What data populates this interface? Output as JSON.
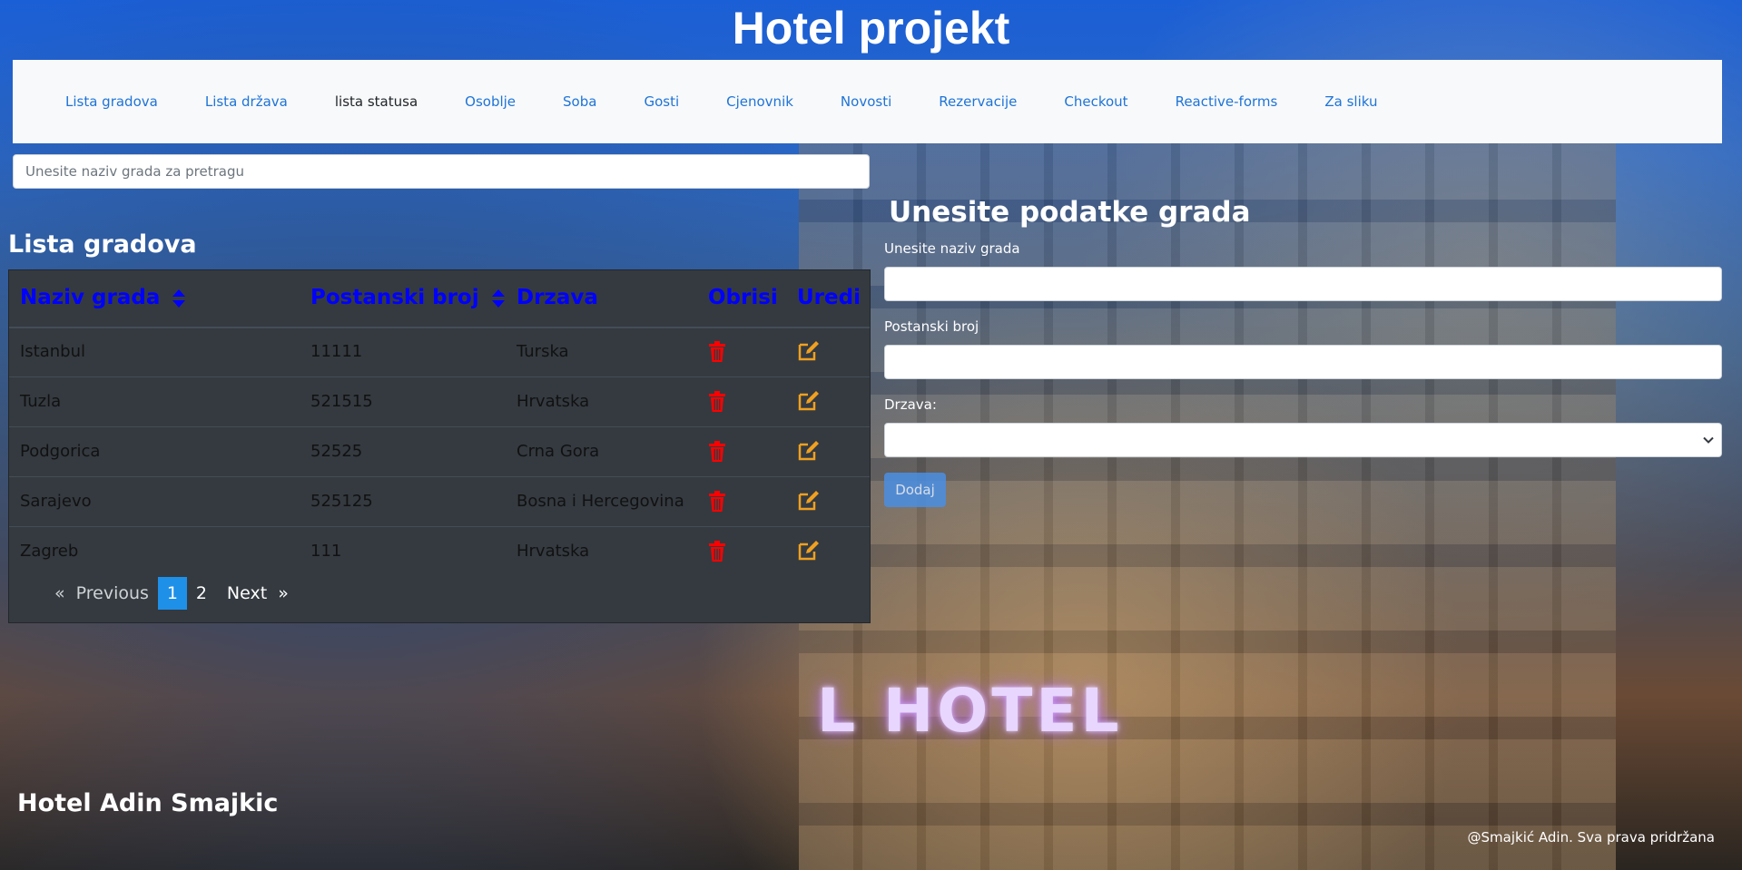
{
  "site": {
    "title": "Hotel projekt"
  },
  "nav": {
    "items": [
      {
        "label": "Lista gradova"
      },
      {
        "label": "Lista država"
      },
      {
        "label": "lista statusa"
      },
      {
        "label": "Osoblje"
      },
      {
        "label": "Soba"
      },
      {
        "label": "Gosti"
      },
      {
        "label": "Cjenovnik"
      },
      {
        "label": "Novosti"
      },
      {
        "label": "Rezervacije"
      },
      {
        "label": "Checkout"
      },
      {
        "label": "Reactive-forms"
      },
      {
        "label": "Za sliku"
      }
    ],
    "active_index": 2,
    "link_color": "#1e74d8",
    "active_color": "#212529"
  },
  "search": {
    "placeholder": "Unesite naziv grada za pretragu",
    "value": ""
  },
  "list": {
    "title": "Lista gradova",
    "columns": [
      {
        "label": "Naziv grada",
        "sortable": true
      },
      {
        "label": "Postanski broj",
        "sortable": true
      },
      {
        "label": "Drzava",
        "sortable": false
      },
      {
        "label": "Obrisi",
        "sortable": false
      },
      {
        "label": "Uredi",
        "sortable": false
      }
    ],
    "rows": [
      {
        "name": "Istanbul",
        "zip": "11111",
        "country": "Turska"
      },
      {
        "name": "Tuzla",
        "zip": "521515",
        "country": "Hrvatska"
      },
      {
        "name": "Podgorica",
        "zip": "52525",
        "country": "Crna Gora"
      },
      {
        "name": "Sarajevo",
        "zip": "525125",
        "country": "Bosna i Hercegovina"
      },
      {
        "name": "Zagreb",
        "zip": "111",
        "country": "Hrvatska"
      }
    ],
    "delete_icon": "trash-icon",
    "edit_icon": "edit-icon",
    "header_color": "#0000ff",
    "delete_color": "#ff0000",
    "edit_color": "#f0a020",
    "table_bg": "#343a40"
  },
  "pagination": {
    "prev_arrow": "«",
    "prev_label": "Previous",
    "pages": [
      "1",
      "2"
    ],
    "current_page": "1",
    "next_label": "Next",
    "next_arrow": "»",
    "current_color": "#1e90e8"
  },
  "form": {
    "title": "Unesite podatke grada",
    "name_label": "Unesite naziv grada",
    "name_value": "",
    "zip_label": "Postanski broj",
    "zip_value": "",
    "country_label": "Drzava:",
    "country_selected": "",
    "submit_label": "Dodaj",
    "submit_color": "#4b8fe3"
  },
  "footer": {
    "title": "Hotel Adin Smajkic",
    "copyright": "@Smajkić Adin. Sva prava pridržana"
  }
}
